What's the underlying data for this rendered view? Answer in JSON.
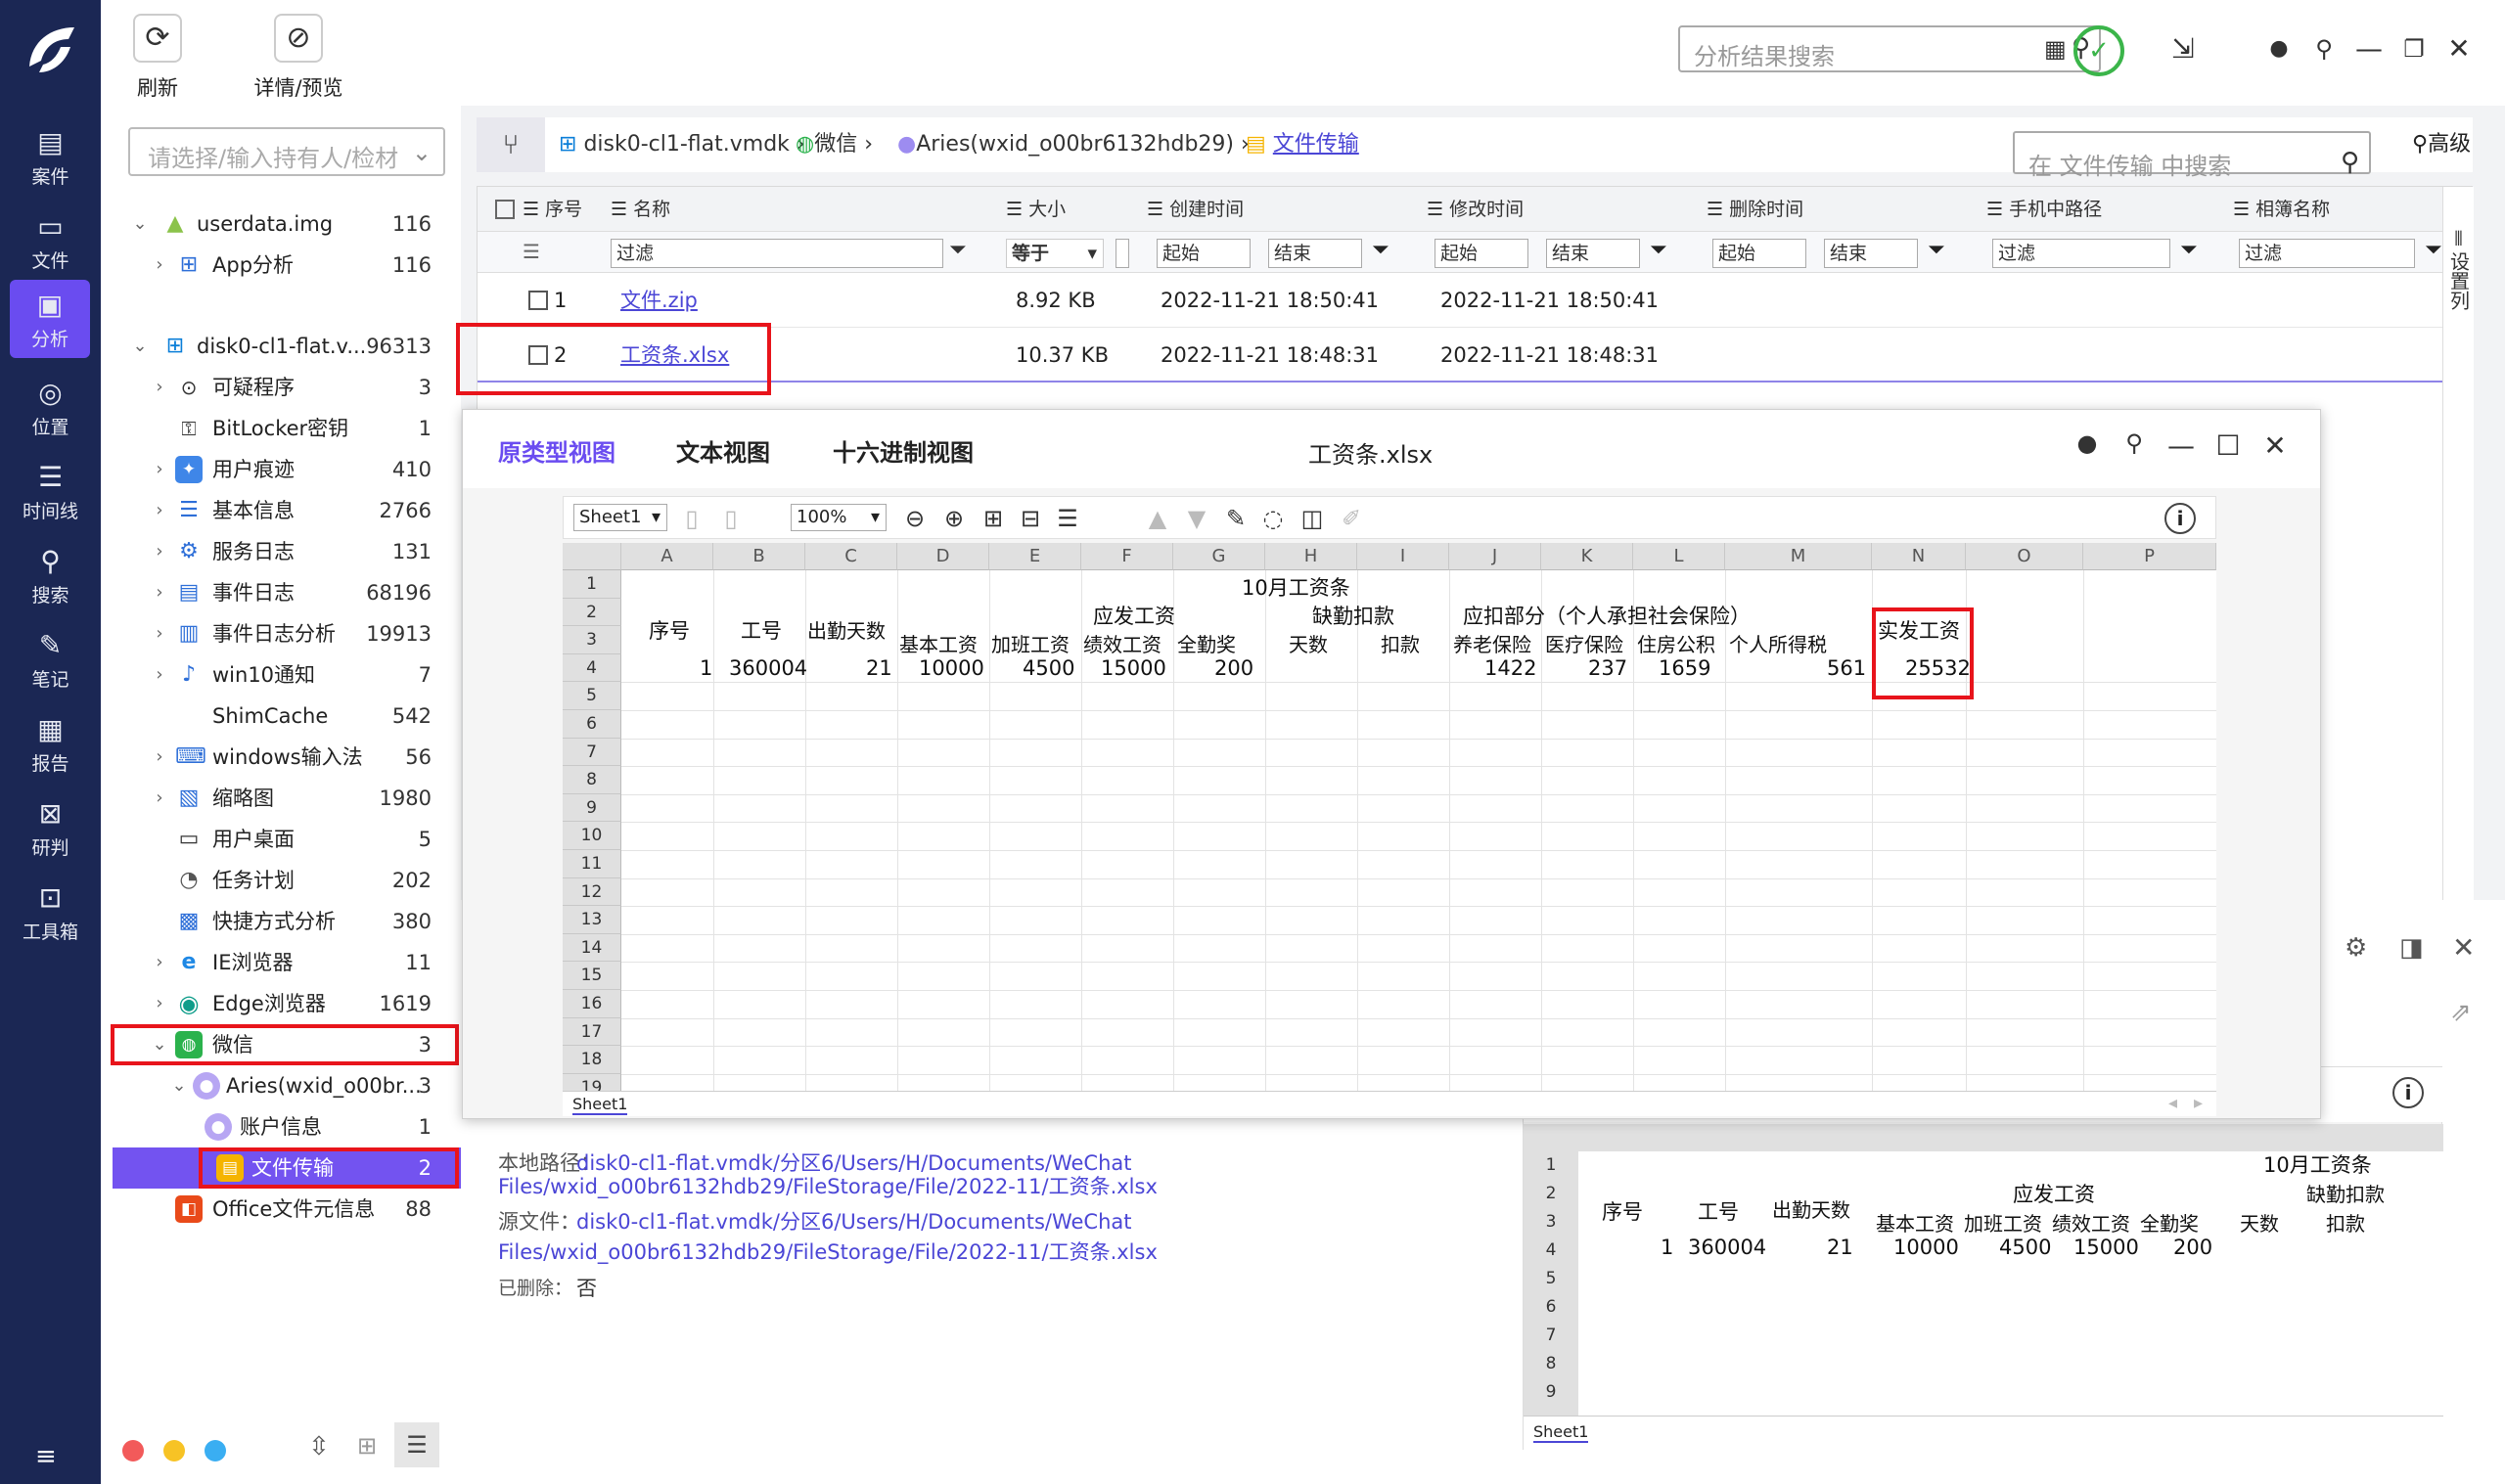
{
  "rail": {
    "items": [
      {
        "label": "案件",
        "icon": "case-icon"
      },
      {
        "label": "文件",
        "icon": "file-icon"
      },
      {
        "label": "分析",
        "icon": "analysis-icon"
      },
      {
        "label": "位置",
        "icon": "location-icon"
      },
      {
        "label": "时间线",
        "icon": "timeline-icon"
      },
      {
        "label": "搜索",
        "icon": "search-icon"
      },
      {
        "label": "笔记",
        "icon": "note-icon"
      },
      {
        "label": "报告",
        "icon": "report-icon"
      },
      {
        "label": "研判",
        "icon": "judge-icon"
      },
      {
        "label": "工具箱",
        "icon": "toolbox-icon"
      }
    ],
    "active_index": 2
  },
  "toolbar": {
    "refresh": "刷新",
    "detail_preview": "详情/预览"
  },
  "top_search": {
    "placeholder": "分析结果搜索"
  },
  "sidebar": {
    "selector_placeholder": "请选择/输入持有人/检材",
    "tree": [
      {
        "label": "userdata.img",
        "count": "116"
      },
      {
        "label": "App分析",
        "count": "116"
      },
      {
        "label": "disk0-cl1-flat.v...",
        "count": "96313"
      },
      {
        "label": "可疑程序",
        "count": "3"
      },
      {
        "label": "BitLocker密钥",
        "count": "1"
      },
      {
        "label": "用户痕迹",
        "count": "410"
      },
      {
        "label": "基本信息",
        "count": "2766"
      },
      {
        "label": "服务日志",
        "count": "131"
      },
      {
        "label": "事件日志",
        "count": "68196"
      },
      {
        "label": "事件日志分析",
        "count": "19913"
      },
      {
        "label": "win10通知",
        "count": "7"
      },
      {
        "label": "ShimCache",
        "count": "542"
      },
      {
        "label": "windows输入法",
        "count": "56"
      },
      {
        "label": "缩略图",
        "count": "1980"
      },
      {
        "label": "用户桌面",
        "count": "5"
      },
      {
        "label": "任务计划",
        "count": "202"
      },
      {
        "label": "快捷方式分析",
        "count": "380"
      },
      {
        "label": "IE浏览器",
        "count": "11"
      },
      {
        "label": "Edge浏览器",
        "count": "1619"
      },
      {
        "label": "微信",
        "count": "3"
      },
      {
        "label": "Aries(wxid_o00br...",
        "count": "3"
      },
      {
        "label": "账户信息",
        "count": "1"
      },
      {
        "label": "文件传输",
        "count": "2"
      },
      {
        "label": "Office文件元信息",
        "count": "88"
      }
    ]
  },
  "breadcrumb": {
    "disk": "disk0-cl1-flat.vmdk",
    "app": "微信",
    "user": "Aries(wxid_o00br6132hdb29)",
    "folder": "文件传输",
    "search_placeholder": "在 文件传输 中搜索",
    "advanced": "高级"
  },
  "grid": {
    "headers": [
      "序号",
      "名称",
      "大小",
      "创建时间",
      "修改时间",
      "删除时间",
      "手机中路径",
      "相簿名称"
    ],
    "filter": {
      "text": "过滤",
      "equals": "等于",
      "start": "起始",
      "end": "结束"
    },
    "side_label": "设置列",
    "rows": [
      {
        "no": "1",
        "name": "文件.zip",
        "size": "8.92 KB",
        "created": "2022-11-21 18:50:41",
        "modified": "2022-11-21 18:50:41"
      },
      {
        "no": "2",
        "name": "工资条.xlsx",
        "size": "10.37 KB",
        "created": "2022-11-21 18:48:31",
        "modified": "2022-11-21 18:48:31"
      }
    ]
  },
  "viewer": {
    "tabs": [
      "原类型视图",
      "文本视图",
      "十六进制视图"
    ],
    "title": "工资条.xlsx",
    "sheet_select": "Sheet1",
    "zoom": "100%",
    "sheet_tab": "Sheet1",
    "columns": [
      "A",
      "B",
      "C",
      "D",
      "E",
      "F",
      "G",
      "H",
      "I",
      "J",
      "K",
      "L",
      "M",
      "N",
      "O",
      "P"
    ],
    "rows": [
      "1",
      "2",
      "3",
      "4",
      "5",
      "6",
      "7",
      "8",
      "9",
      "10",
      "11",
      "12",
      "13",
      "14",
      "15",
      "16",
      "17",
      "18",
      "19"
    ],
    "cells": {
      "title": "10月工资条",
      "h_xuhao": "序号",
      "h_gonghao": "工号",
      "h_days": "出勤天数",
      "h_yingfa": "应发工资",
      "h_queqin": "缺勤扣款",
      "h_yingkou": "应扣部分（个人承担社会保险）",
      "h_shifa": "实发工资",
      "h_base": "基本工资",
      "h_overtime": "加班工资",
      "h_perf": "绩效工资",
      "h_full": "全勤奖",
      "h_tianshu": "天数",
      "h_kou": "扣款",
      "h_pension": "养老保险",
      "h_medical": "医疗保险",
      "h_housing": "住房公积",
      "h_tax": "个人所得税",
      "v_no": "1",
      "v_id": "360004",
      "v_days": "21",
      "v_base": "10000",
      "v_overtime": "4500",
      "v_perf": "15000",
      "v_full": "200",
      "v_pension": "1422",
      "v_medical": "237",
      "v_housing": "1659",
      "v_tax": "561",
      "v_net": "25532"
    }
  },
  "detail": {
    "local_path_label": "本地路径：",
    "local_path_line1": "disk0-cl1-flat.vmdk/分区6/Users/H/Documents/WeChat",
    "local_path_line2": "Files/wxid_o00br6132hdb29/FileStorage/File/2022-11/工资条.xlsx",
    "source_label": "源文件：",
    "source_line1": "disk0-cl1-flat.vmdk/分区6/Users/H/Documents/WeChat",
    "source_line2": "Files/wxid_o00br6132hdb29/FileStorage/File/2022-11/工资条.xlsx",
    "deleted_label": "已删除：",
    "deleted_value": "否"
  },
  "preview": {
    "rows": [
      "1",
      "2",
      "3",
      "4",
      "5",
      "6",
      "7",
      "8",
      "9"
    ],
    "title": "10月工资条",
    "h_xuhao": "序号",
    "h_gonghao": "工号",
    "h_days": "出勤天数",
    "h_yingfa": "应发工资",
    "h_queqin": "缺勤扣款",
    "h_base": "基本工资",
    "h_overtime": "加班工资",
    "h_perf": "绩效工资",
    "h_full": "全勤奖",
    "h_tianshu": "天数",
    "h_kou": "扣款",
    "v_no": "1",
    "v_id": "360004",
    "v_days": "21",
    "v_base": "10000",
    "v_overtime": "4500",
    "v_perf": "15000",
    "v_full": "200",
    "sheet_tab": "Sheet1"
  },
  "colors": {
    "rail": "#1b2754",
    "accent": "#6a4cf0",
    "highlight_box": "#e8141b",
    "link": "#4b46d6"
  }
}
